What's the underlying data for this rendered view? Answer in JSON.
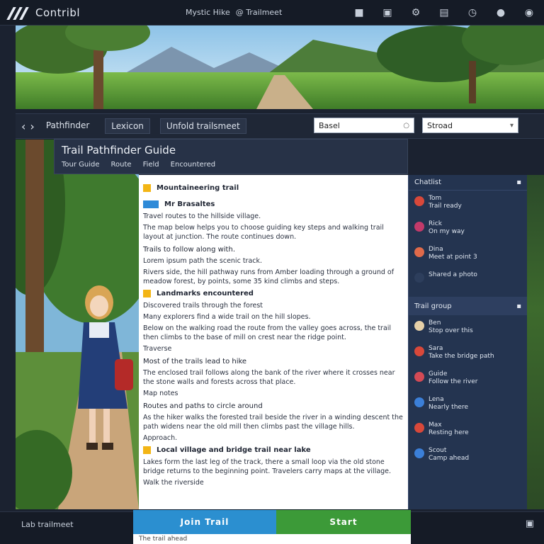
{
  "app": {
    "title": "Contribl"
  },
  "topbar": {
    "links": [
      "Mystic Hike",
      "@ Trailmeet"
    ],
    "icons": [
      "flag-icon",
      "bookmark-icon",
      "gear-icon",
      "book-icon",
      "clock-icon",
      "avatar-icon",
      "settings-icon"
    ]
  },
  "toolbar": {
    "crumbs": [
      "Pathfinder",
      "Lexicon",
      "Unfold trailsmeet"
    ],
    "select_one": "Basel",
    "select_two": "Stroad"
  },
  "heading": {
    "title": "Trail Pathfinder Guide",
    "tabs": [
      "Tour Guide",
      "Route",
      "Field",
      "Encountered"
    ]
  },
  "document": {
    "top_tag": "Mountaineering trail",
    "section_main": "Mr Brasaltes",
    "p1": "Travel routes to the hillside village.",
    "p2": "The map below helps you to choose guiding key steps and walking trail layout at junction. The route continues down.",
    "p3": "Trails to follow along with.",
    "p4": "Lorem ipsum path the scenic track.",
    "p5": "Rivers side, the hill pathway runs from Amber loading through a ground of meadow forest, by points, some 35 kind climbs and steps.",
    "section_two": "Landmarks encountered",
    "p6": "Discovered trails through the forest",
    "p7": "Many explorers find a wide trail on the hill slopes.",
    "p8": "Below on the walking road the route from the valley goes across, the trail then climbs to the base of mill on crest near the ridge point.",
    "p9": "Traverse",
    "sub1": "Most of the trails lead to hike",
    "p10": "The enclosed trail follows along the bank of the river where it crosses near the stone walls and forests across that place.",
    "p11": "Map notes",
    "sub2": "Routes and paths to circle around",
    "p12": "As the hiker walks the forested trail beside the river in a winding descent the path widens near the old mill then climbs past the village hills.",
    "p13": "Approach.",
    "section_three": "Local village and bridge trail near lake",
    "p14": "Lakes form the last leg of the track, there a small loop via the old stone bridge returns to the beginning point. Travelers carry maps at the village.",
    "p15": "Walk the riverside"
  },
  "rpanel": {
    "header": "Chatlist",
    "items": [
      {
        "name": "Tom",
        "msg": "Trail ready",
        "color": "#d8483a"
      },
      {
        "name": "Rick",
        "msg": "On my way",
        "color": "#c33a6a"
      },
      {
        "name": "Dina",
        "msg": "Meet at point 3",
        "color": "#e06a4a"
      },
      {
        "name": "",
        "msg": "Shared a photo",
        "color": "#2d3e5c"
      }
    ],
    "group_label": "Trail group",
    "group_items": [
      {
        "name": "Ben",
        "msg": "Stop over this",
        "color": "#e6d0a8"
      },
      {
        "name": "Sara",
        "msg": "Take the bridge path",
        "color": "#d8483a"
      },
      {
        "name": "Guide",
        "msg": "Follow the river",
        "color": "#d44a55"
      },
      {
        "name": "Lena",
        "msg": "Nearly there",
        "color": "#3b7fd8"
      },
      {
        "name": "Max",
        "msg": "Resting here",
        "color": "#d8483a"
      },
      {
        "name": "Scout",
        "msg": "Camp ahead",
        "color": "#3b7fd8"
      }
    ]
  },
  "bottom": {
    "status": "Lab trailmeet",
    "blue_button": "Join Trail",
    "green_button": "Start",
    "strip_text": "The trail ahead"
  },
  "colors": {
    "accent_blue": "#2b8fd0",
    "accent_green": "#3c9a38",
    "accent_yellow": "#f3b515"
  }
}
